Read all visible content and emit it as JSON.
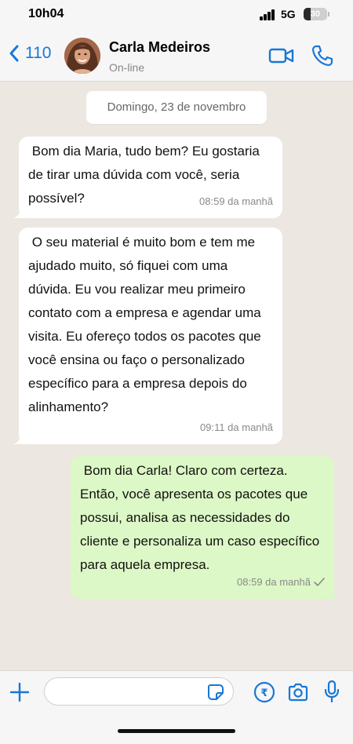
{
  "status_bar": {
    "time": "10h04",
    "network": "5G",
    "battery_level": "30"
  },
  "header": {
    "back_count": "110",
    "contact_name": "Carla Medeiros",
    "contact_status": "On-line",
    "avatar": "contact-photo",
    "video_icon": "video-call-icon",
    "call_icon": "phone-icon",
    "accent_color": "#1877d6"
  },
  "chat": {
    "date_label": "Domingo, 23 de novembro",
    "messages": [
      {
        "direction": "in",
        "text": " Bom dia Maria, tudo bem? Eu gostaria de tirar uma dúvida com você, seria possível?",
        "time": "08:59 da manhã"
      },
      {
        "direction": "in",
        "text": " O seu material é muito bom e tem me ajudado muito, só fiquei com uma dúvida. Eu vou realizar meu primeiro contato com a empresa e agendar uma visita. Eu ofereço todos os pacotes que você ensina ou faço o personalizado específico para a empresa depois do alinhamento?",
        "time": "09:11 da manhã"
      },
      {
        "direction": "out",
        "text": " Bom dia Carla! Claro com certeza. Então, você apresenta os pacotes que possui, analisa as necessidades do cliente e personaliza um caso específico para aquela empresa.",
        "time": "08:59 da manhã",
        "status_icon": "single-check-icon"
      }
    ],
    "incoming_color": "#ffffff",
    "outgoing_color": "#dcf8c6"
  },
  "composer": {
    "input_value": "",
    "icons": [
      "plus-icon",
      "sticker-icon",
      "payment-icon",
      "camera-icon",
      "microphone-icon"
    ]
  }
}
